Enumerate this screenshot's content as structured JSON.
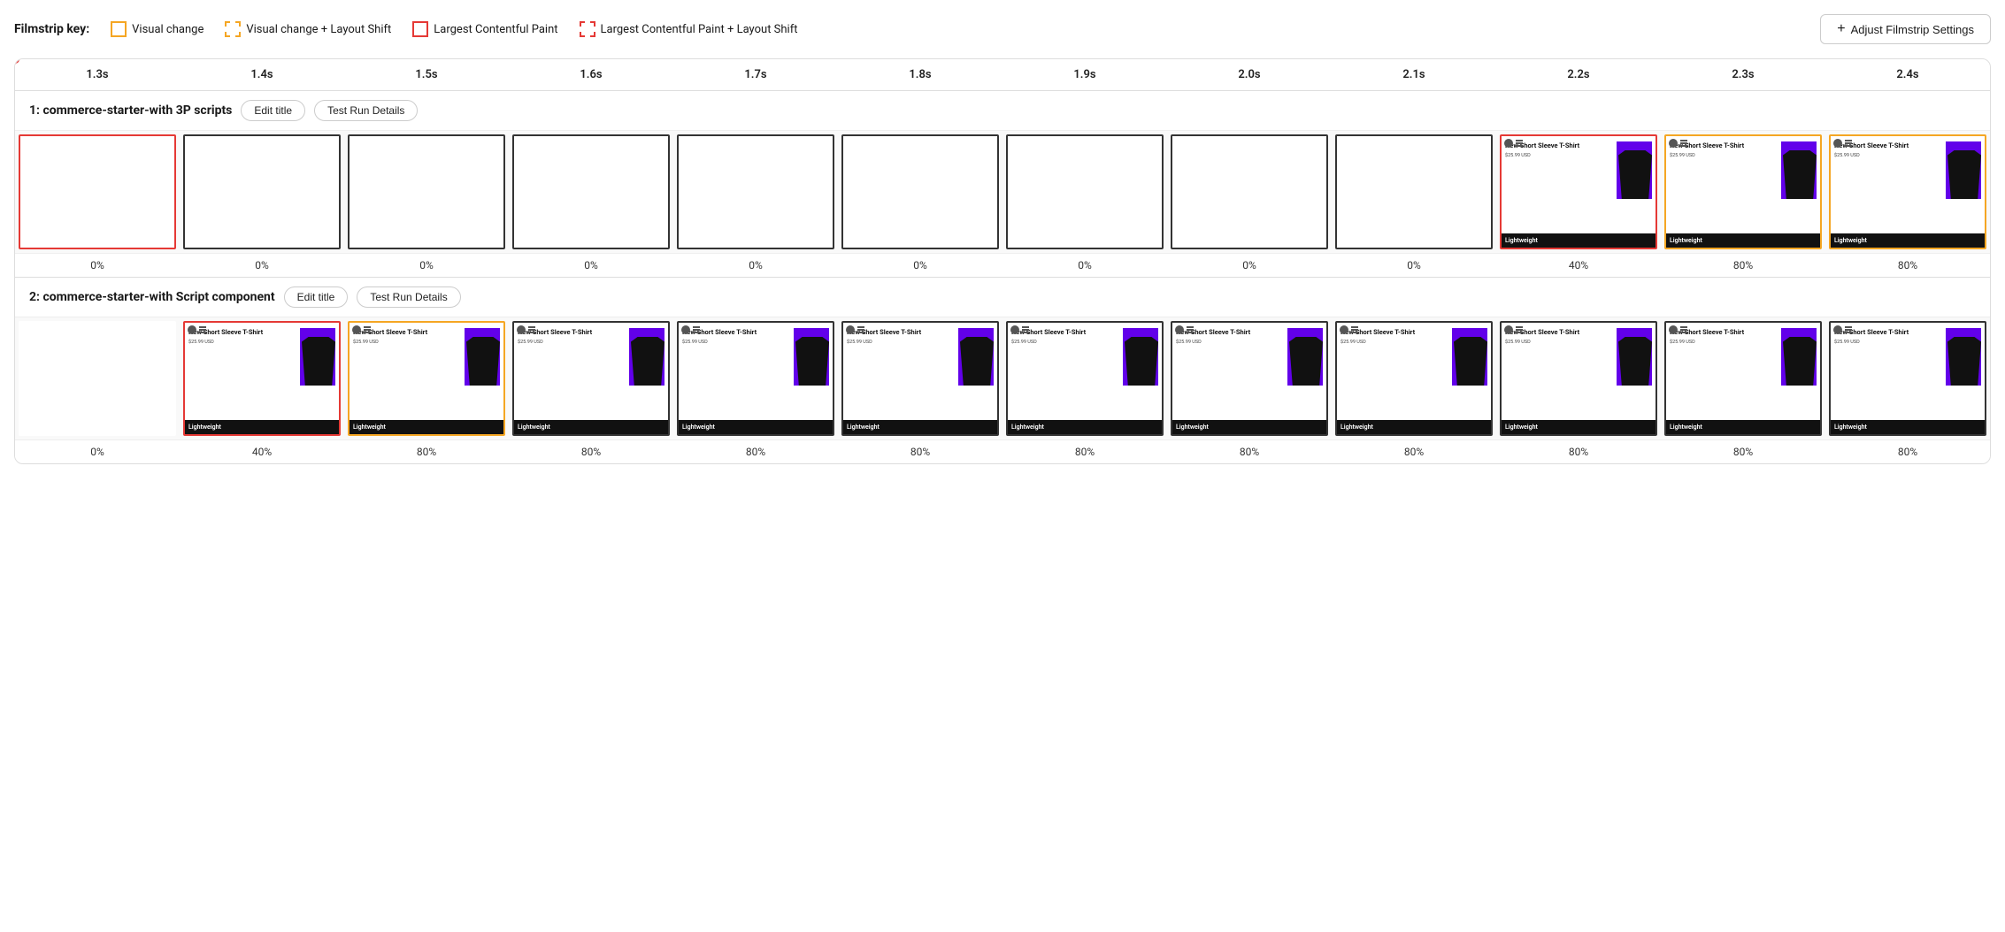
{
  "legend": {
    "title": "Filmstrip key:",
    "items": [
      {
        "id": "visual-change",
        "label": "Visual change",
        "border": "solid-yellow"
      },
      {
        "id": "visual-change-layout",
        "label": "Visual change + Layout Shift",
        "border": "dashed-yellow"
      },
      {
        "id": "lcp",
        "label": "Largest Contentful Paint",
        "border": "solid-red"
      },
      {
        "id": "lcp-layout",
        "label": "Largest Contentful Paint + Layout Shift",
        "border": "dashed-red"
      }
    ],
    "adjust_button": "Adjust Filmstrip Settings"
  },
  "timeline": {
    "ticks": [
      "1.3s",
      "1.4s",
      "1.5s",
      "1.6s",
      "1.7s",
      "1.8s",
      "1.9s",
      "2.0s",
      "2.1s",
      "2.2s",
      "2.3s",
      "2.4s"
    ]
  },
  "sections": [
    {
      "id": "section-1",
      "title": "1: commerce-starter-with 3P scripts",
      "edit_title_label": "Edit title",
      "test_run_label": "Test Run Details",
      "frames": [
        {
          "border": "border-red",
          "type": "empty"
        },
        {
          "border": "border-black",
          "type": "empty"
        },
        {
          "border": "border-black",
          "type": "empty"
        },
        {
          "border": "border-black",
          "type": "empty"
        },
        {
          "border": "border-black",
          "type": "empty"
        },
        {
          "border": "border-black",
          "type": "empty"
        },
        {
          "border": "border-black",
          "type": "empty"
        },
        {
          "border": "border-black",
          "type": "empty"
        },
        {
          "border": "border-black",
          "type": "empty"
        },
        {
          "border": "border-red",
          "type": "product"
        },
        {
          "border": "border-yellow",
          "type": "product"
        },
        {
          "border": "border-yellow",
          "type": "product"
        }
      ],
      "percentages": [
        "0%",
        "0%",
        "0%",
        "0%",
        "0%",
        "0%",
        "0%",
        "0%",
        "0%",
        "40%",
        "80%",
        "80%"
      ]
    },
    {
      "id": "section-2",
      "title": "2: commerce-starter-with Script component",
      "edit_title_label": "Edit title",
      "test_run_label": "Test Run Details",
      "frames": [
        {
          "border": "border-none",
          "type": "empty"
        },
        {
          "border": "border-red",
          "type": "product"
        },
        {
          "border": "border-yellow",
          "type": "product"
        },
        {
          "border": "border-black",
          "type": "product"
        },
        {
          "border": "border-black",
          "type": "product"
        },
        {
          "border": "border-black",
          "type": "product"
        },
        {
          "border": "border-black",
          "type": "product"
        },
        {
          "border": "border-black",
          "type": "product"
        },
        {
          "border": "border-black",
          "type": "product"
        },
        {
          "border": "border-black",
          "type": "product"
        },
        {
          "border": "border-black",
          "type": "product"
        },
        {
          "border": "border-black",
          "type": "product"
        }
      ],
      "percentages": [
        "0%",
        "40%",
        "80%",
        "80%",
        "80%",
        "80%",
        "80%",
        "80%",
        "80%",
        "80%",
        "80%",
        "80%"
      ]
    }
  ],
  "product": {
    "title": "New Short Sleeve T-Shirt",
    "price": "$25.99 USD",
    "badge": "Lightweight"
  }
}
